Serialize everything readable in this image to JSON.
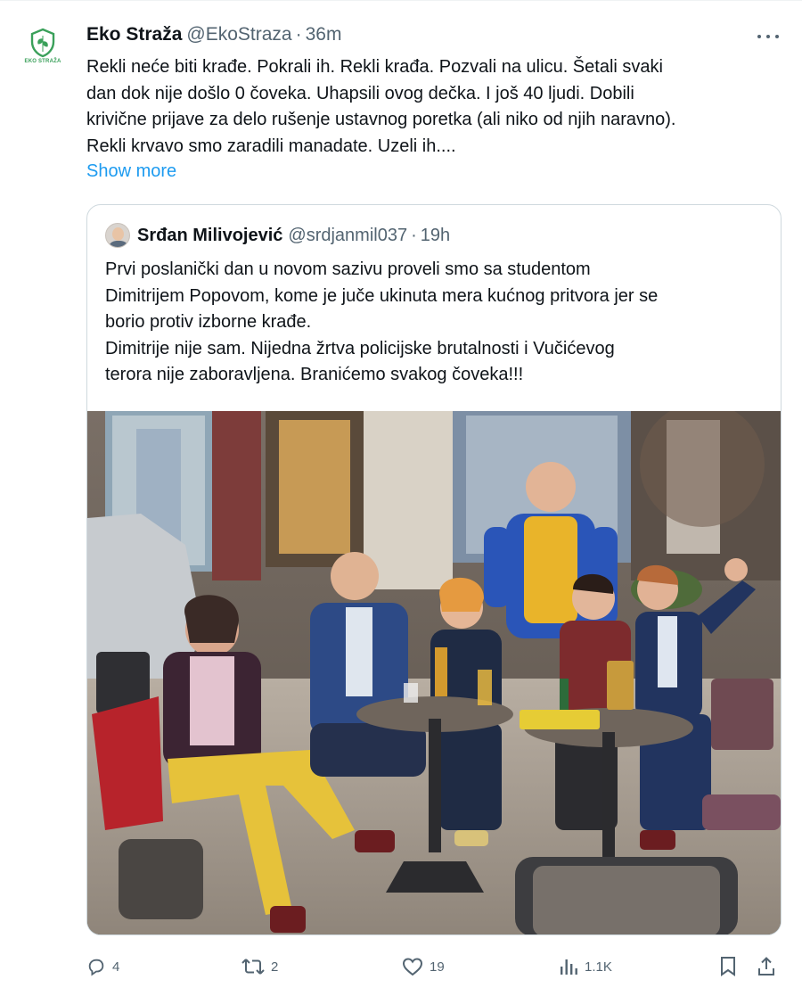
{
  "tweet": {
    "author_name": "Eko Straža",
    "author_handle": "@EkoStraza",
    "separator": "·",
    "time": "36m",
    "avatar_text": "EKO STRAŽA",
    "text": "Rekli neće biti krađe. Pokrali ih. Rekli krađa. Pozvali na ulicu. Šetali svaki\ndan dok nije došlo 0 čoveka. Uhapsili ovog dečka. I još 40 ljudi. Dobili\nkrivične prijave za delo rušenje ustavnog poretka (ali niko od njih naravno).\nRekli krvavo smo zaradili manadate. Uzeli ih....",
    "show_more": "Show more"
  },
  "quote": {
    "author_name": "Srđan Milivojević",
    "author_handle": "@srdjanmil037",
    "separator": "·",
    "time": "19h",
    "text": "Prvi poslanički dan u novom sazivu proveli smo sa studentom\nDimitrijem Popovom, kome je juče ukinuta mera kućnog pritvora jer se\nborio protiv izborne krađe.\nDimitrije nije sam. Nijedna žrtva policijske brutalnosti i Vučićevog\nterora nije zaboravljena. Branićemo svakog čoveka!!!"
  },
  "actions": {
    "replies": "4",
    "reposts": "2",
    "likes": "19",
    "views": "1.1K"
  },
  "icons": {
    "reply": "reply-icon",
    "repost": "repost-icon",
    "like": "heart-icon",
    "views": "views-icon",
    "bookmark": "bookmark-icon",
    "share": "share-icon",
    "more": "more-icon"
  },
  "colors": {
    "accent": "#1d9bf0",
    "secondary_text": "#536471",
    "border": "#cfd9de",
    "logo_green": "#3aa05a"
  }
}
